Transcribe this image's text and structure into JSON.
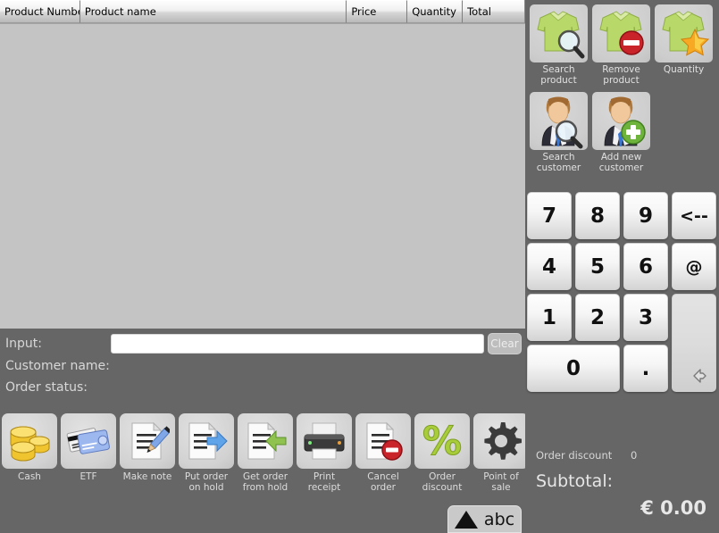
{
  "table": {
    "columns": [
      "Product Number",
      "Product name",
      "Price",
      "Quantity",
      "Total"
    ],
    "rows": []
  },
  "form": {
    "input_label": "Input:",
    "input_value": "",
    "input_placeholder": "",
    "clear_label": "Clear",
    "customer_label": "Customer name:",
    "customer_value": "",
    "status_label": "Order status:",
    "status_value": ""
  },
  "actions": [
    {
      "name": "search-product",
      "label": "Search\nproduct",
      "icon": "shirt-search-icon"
    },
    {
      "name": "remove-product",
      "label": "Remove\nproduct",
      "icon": "shirt-remove-icon"
    },
    {
      "name": "quantity",
      "label": "Quantity",
      "icon": "shirt-star-icon"
    },
    {
      "name": "search-customer",
      "label": "Search\ncustomer",
      "icon": "person-search-icon"
    },
    {
      "name": "add-new-customer",
      "label": "Add new\ncustomer",
      "icon": "person-add-icon"
    }
  ],
  "keypad": {
    "keys": [
      "7",
      "8",
      "9",
      "<--",
      "4",
      "5",
      "6",
      "@",
      "1",
      "2",
      "3",
      "0",
      "."
    ],
    "enter_icon": "enter-arrow-icon"
  },
  "toolbar": [
    {
      "name": "cash",
      "label": "Cash",
      "icon": "coins-icon"
    },
    {
      "name": "etf",
      "label": "ETF",
      "icon": "credit-card-icon"
    },
    {
      "name": "make-note",
      "label": "Make note",
      "icon": "note-pencil-icon"
    },
    {
      "name": "put-order-hold",
      "label": "Put order\non hold",
      "icon": "document-arrow-right-icon"
    },
    {
      "name": "get-order-hold",
      "label": "Get order\nfrom hold",
      "icon": "document-arrow-left-icon"
    },
    {
      "name": "print-receipt",
      "label": "Print\nreceipt",
      "icon": "printer-icon"
    },
    {
      "name": "cancel-order",
      "label": "Cancel\norder",
      "icon": "document-cancel-icon"
    },
    {
      "name": "order-discount",
      "label": "Order\ndiscount",
      "icon": "percent-icon"
    },
    {
      "name": "point-of-sale",
      "label": "Point of\nsale",
      "icon": "gear-icon"
    }
  ],
  "totals": {
    "discount_label": "Order discount",
    "discount_value": "0",
    "subtotal_label": "Subtotal:",
    "subtotal_value": "€ 0.00"
  },
  "keyboard_toggle": {
    "label": "abc",
    "icon": "triangle-up-icon"
  },
  "colors": {
    "background": "#666666",
    "table_body": "#c4c4c4",
    "accent_green": "#a8d05a",
    "accent_red": "#c8242a",
    "text_light": "#d8d8d8"
  }
}
